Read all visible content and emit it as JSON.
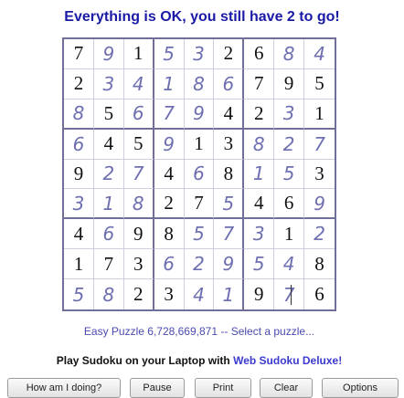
{
  "status_message": "Everything is OK, you still have 2 to go!",
  "board": {
    "colors": {
      "given": "#111111",
      "user": "#6d6fb1",
      "grid": "#6f6f9a"
    },
    "cells": [
      [
        "7",
        "9",
        "1",
        "5",
        "3",
        "2",
        "6",
        "8",
        "4"
      ],
      [
        "2",
        "3",
        "4",
        "1",
        "8",
        "6",
        "7",
        "9",
        "5"
      ],
      [
        "8",
        "5",
        "6",
        "7",
        "9",
        "4",
        "2",
        "3",
        "1"
      ],
      [
        "6",
        "4",
        "5",
        "9",
        "1",
        "3",
        "8",
        "2",
        "7"
      ],
      [
        "9",
        "2",
        "7",
        "4",
        "6",
        "8",
        "1",
        "5",
        "3"
      ],
      [
        "3",
        "1",
        "8",
        "2",
        "7",
        "5",
        "4",
        "6",
        "9"
      ],
      [
        "4",
        "6",
        "9",
        "8",
        "5",
        "7",
        "3",
        "1",
        "2"
      ],
      [
        "1",
        "7",
        "3",
        "6",
        "2",
        "9",
        "5",
        "4",
        "8"
      ],
      [
        "5",
        "8",
        "2",
        "3",
        "4",
        "1",
        "9",
        "7",
        "6"
      ]
    ],
    "given": [
      [
        1,
        0,
        1,
        0,
        0,
        1,
        1,
        0,
        0
      ],
      [
        1,
        0,
        0,
        0,
        0,
        0,
        1,
        1,
        1
      ],
      [
        0,
        1,
        0,
        0,
        0,
        1,
        1,
        0,
        1
      ],
      [
        0,
        1,
        1,
        0,
        1,
        1,
        0,
        0,
        0
      ],
      [
        1,
        0,
        0,
        1,
        0,
        1,
        0,
        0,
        1
      ],
      [
        0,
        0,
        0,
        1,
        1,
        0,
        1,
        1,
        0
      ],
      [
        1,
        0,
        1,
        1,
        0,
        0,
        0,
        1,
        0
      ],
      [
        1,
        1,
        1,
        0,
        0,
        0,
        0,
        0,
        1
      ],
      [
        0,
        0,
        1,
        1,
        0,
        0,
        1,
        0,
        1
      ]
    ],
    "active_cell": "r8c7"
  },
  "puzzle_info": {
    "level": "Easy Puzzle 6,728,669,871",
    "separator": " -- ",
    "select_link": "Select a puzzle..."
  },
  "promo": {
    "text": "Play Sudoku on your Laptop with ",
    "link": "Web Sudoku Deluxe!"
  },
  "buttons": [
    {
      "id": "how-am-i-doing",
      "label": "How am I doing?"
    },
    {
      "id": "pause",
      "label": "Pause"
    },
    {
      "id": "print",
      "label": "Print"
    },
    {
      "id": "clear",
      "label": "Clear"
    },
    {
      "id": "options",
      "label": "Options"
    }
  ]
}
